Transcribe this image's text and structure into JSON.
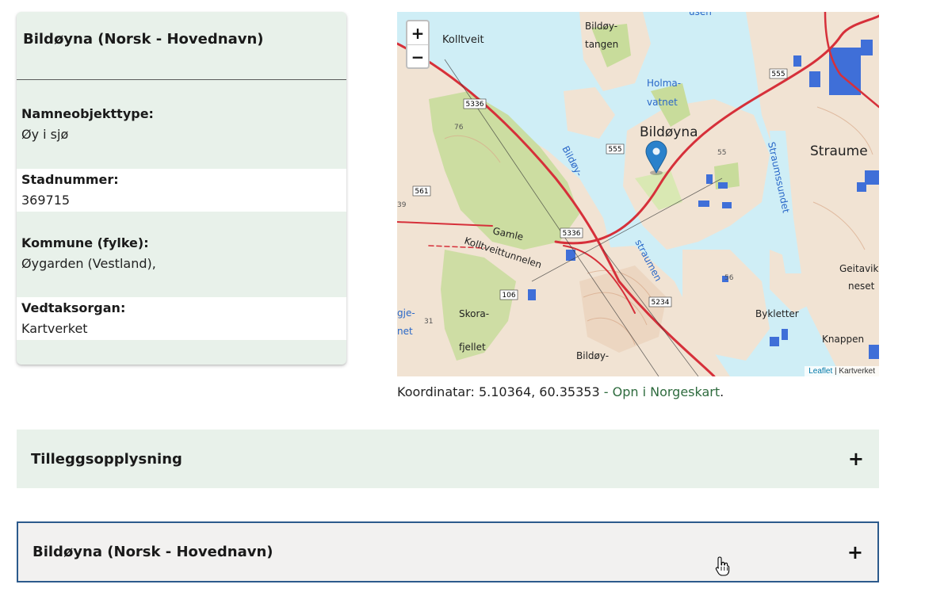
{
  "card": {
    "title": "Bildøyna (Norsk - Hovednavn)",
    "fields": [
      {
        "label": "Namneobjekttype:",
        "value": "Øy i sjø"
      },
      {
        "label": "Stadnummer:",
        "value": "369715"
      },
      {
        "label": "Kommune (fylke):",
        "value": "Øygarden (Vestland),"
      },
      {
        "label": "Vedtaksorgan:",
        "value": "Kartverket"
      }
    ]
  },
  "map": {
    "zoom_in": "+",
    "zoom_out": "−",
    "attribution_link": "Leaflet",
    "attribution_sep": " | ",
    "attribution_text": "Kartverket",
    "labels": {
      "kolltveit": "Kolltveit",
      "bildoy_tangen_1": "Bildøy-",
      "bildoy_tangen_2": "tangen",
      "holma_1": "Holma-",
      "holma_2": "vatnet",
      "bildoyna": "Bildøyna",
      "straume": "Straume",
      "straumssundet": "Straumssundet",
      "bildoy_straumen_1": "Bildøy-",
      "bildoy_straumen_2": "straumen",
      "gamle": "Gamle",
      "kolltveittunnelen": "Kolltveittunnelen",
      "skora_1": "Skora-",
      "skora_2": "fjellet",
      "bildoy_bottom": "Bildøy-",
      "geitavik_1": "Geitavik",
      "geitavik_2": "neset",
      "bykletter": "Bykletter",
      "knappen": "Knappen",
      "gje": "gje-",
      "net": "net",
      "usen": "usen",
      "r555a": "555",
      "r555b": "555",
      "r5336a": "5336",
      "r5336b": "5336",
      "r5234": "5234",
      "r561": "561",
      "r106": "106",
      "h76": "76",
      "h55": "55",
      "h56": "56",
      "h31": "31",
      "h39": "39"
    }
  },
  "coordinates": {
    "prefix": "Koordinatar: 5.10364, 60.35353",
    "sep": " - ",
    "link": "Opn i Norgeskart",
    "suffix": "."
  },
  "accordions": [
    {
      "title": "Tilleggsopplysning",
      "icon": "+"
    },
    {
      "title": "Bildøyna (Norsk - Hovednavn)",
      "icon": "+"
    }
  ],
  "colors": {
    "card_bg": "#e8f1ea",
    "water": "#cfeef6",
    "land": "#f1e3d3",
    "forest": "#c8dc9b",
    "road": "#d6303a",
    "link": "#2e6b3e",
    "marker": "#2a81cb",
    "focus_border": "#2c5a8c"
  },
  "icons": [
    "map-marker-icon",
    "hand-cursor-icon",
    "plus-icon"
  ]
}
